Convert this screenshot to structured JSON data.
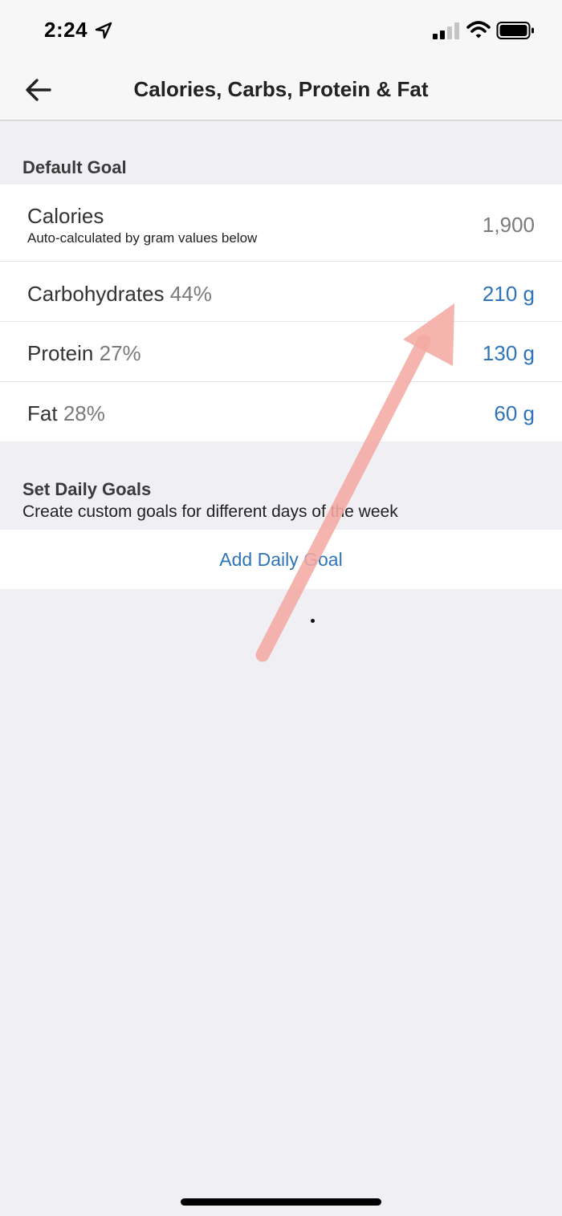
{
  "status_bar": {
    "time": "2:24",
    "icons": [
      "location-arrow-icon",
      "cellular-signal-icon",
      "wifi-icon",
      "battery-icon"
    ]
  },
  "nav": {
    "title": "Calories, Carbs, Protein & Fat",
    "back_icon": "back-arrow-icon"
  },
  "default_goal": {
    "header": "Default Goal",
    "calories": {
      "label": "Calories",
      "subtitle": "Auto-calculated by gram values below",
      "value": "1,900"
    },
    "macros": [
      {
        "label": "Carbohydrates",
        "percent": "44%",
        "value": "210 g"
      },
      {
        "label": "Protein",
        "percent": "27%",
        "value": "130 g"
      },
      {
        "label": "Fat",
        "percent": "28%",
        "value": "60 g"
      }
    ]
  },
  "daily_goals": {
    "header": "Set Daily Goals",
    "subtitle": "Create custom goals for different days of the week",
    "add_button": "Add Daily Goal"
  },
  "colors": {
    "accent": "#2f73b8",
    "annotation_arrow": "#f4aaa3",
    "background": "#efeff4"
  }
}
